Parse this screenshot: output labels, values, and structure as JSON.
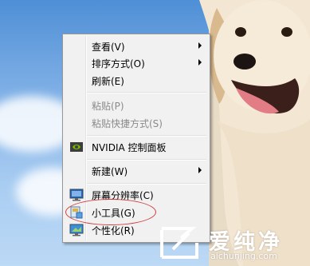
{
  "menu": {
    "items": [
      {
        "label": "查看(V)"
      },
      {
        "label": "排序方式(O)"
      },
      {
        "label": "刷新(E)"
      },
      {
        "label": "粘贴(P)"
      },
      {
        "label": "粘贴快捷方式(S)"
      },
      {
        "label": "NVIDIA 控制面板"
      },
      {
        "label": "新建(W)"
      },
      {
        "label": "屏幕分辨率(C)"
      },
      {
        "label": "小工具(G)"
      },
      {
        "label": "个性化(R)"
      }
    ]
  },
  "watermark": {
    "title": "爱纯净",
    "url": "aichunjing.com"
  },
  "colors": {
    "highlight_oval": "#d04040",
    "sky": "#7fb0e6",
    "menu_bg": "#f1f1f1"
  }
}
